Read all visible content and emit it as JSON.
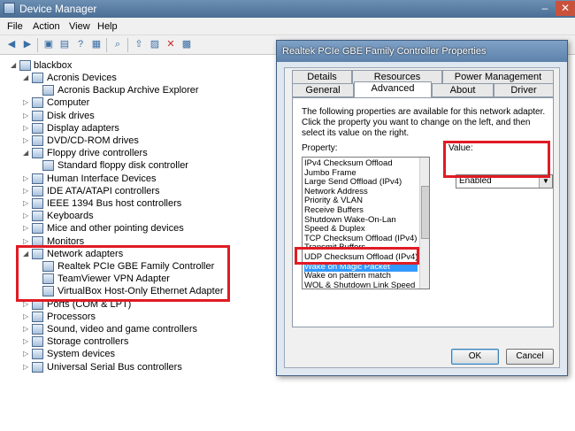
{
  "window": {
    "title": "Device Manager",
    "minimize": "–",
    "close": "✕"
  },
  "menu": [
    "File",
    "Action",
    "View",
    "Help"
  ],
  "toolbar_icons": [
    "back-icon",
    "forward-icon",
    "properties-icon",
    "console-tree-icon",
    "help-icon",
    "device-properties-icon",
    "scan-hardware-icon",
    "update-driver-icon",
    "uninstall-icon",
    "disable-icon"
  ],
  "tree": {
    "root": "blackbox",
    "items": [
      {
        "label": "Acronis Devices",
        "expander": "◢"
      },
      {
        "label": "Acronis Backup Archive Explorer",
        "expander": ""
      },
      {
        "label": "Computer",
        "expander": "▷"
      },
      {
        "label": "Disk drives",
        "expander": "▷"
      },
      {
        "label": "Display adapters",
        "expander": "▷"
      },
      {
        "label": "DVD/CD-ROM drives",
        "expander": "▷"
      },
      {
        "label": "Floppy drive controllers",
        "expander": "◢"
      },
      {
        "label": "Standard floppy disk controller",
        "expander": ""
      },
      {
        "label": "Human Interface Devices",
        "expander": "▷"
      },
      {
        "label": "IDE ATA/ATAPI controllers",
        "expander": "▷"
      },
      {
        "label": "IEEE 1394 Bus host controllers",
        "expander": "▷"
      },
      {
        "label": "Keyboards",
        "expander": "▷"
      },
      {
        "label": "Mice and other pointing devices",
        "expander": "▷"
      },
      {
        "label": "Monitors",
        "expander": "▷"
      },
      {
        "label": "Network adapters",
        "expander": "◢"
      },
      {
        "label": "Realtek PCIe GBE Family Controller",
        "expander": ""
      },
      {
        "label": "TeamViewer VPN Adapter",
        "expander": ""
      },
      {
        "label": "VirtualBox Host-Only Ethernet Adapter",
        "expander": ""
      },
      {
        "label": "Ports (COM & LPT)",
        "expander": "▷"
      },
      {
        "label": "Processors",
        "expander": "▷"
      },
      {
        "label": "Sound, video and game controllers",
        "expander": "▷"
      },
      {
        "label": "Storage controllers",
        "expander": "▷"
      },
      {
        "label": "System devices",
        "expander": "▷"
      },
      {
        "label": "Universal Serial Bus controllers",
        "expander": "▷"
      }
    ]
  },
  "dialog": {
    "title": "Realtek PCIe GBE Family Controller Properties",
    "tabs_back": [
      "Details",
      "Resources",
      "Power Management"
    ],
    "tabs_front": [
      "General",
      "Advanced",
      "About",
      "Driver"
    ],
    "description": "The following properties are available for this network adapter. Click the property you want to change on the left, and then select its value on the right.",
    "property_label": "Property:",
    "value_label": "Value:",
    "properties": [
      "IPv4 Checksum Offload",
      "Jumbo Frame",
      "Large Send Offload (IPv4)",
      "Network Address",
      "Priority & VLAN",
      "Receive Buffers",
      "Shutdown Wake-On-Lan",
      "Speed & Duplex",
      "TCP Checksum Offload (IPv4)",
      "Transmit Buffers",
      "UDP Checksum Offload (IPv4)",
      "Wake on Magic Packet",
      "Wake on pattern match",
      "WOL & Shutdown Link Speed"
    ],
    "selected_property": "Wake on Magic Packet",
    "value": "Enabled",
    "ok": "OK",
    "cancel": "Cancel"
  },
  "highlight_color": "#e01b24",
  "selection_color": "#3399ff"
}
